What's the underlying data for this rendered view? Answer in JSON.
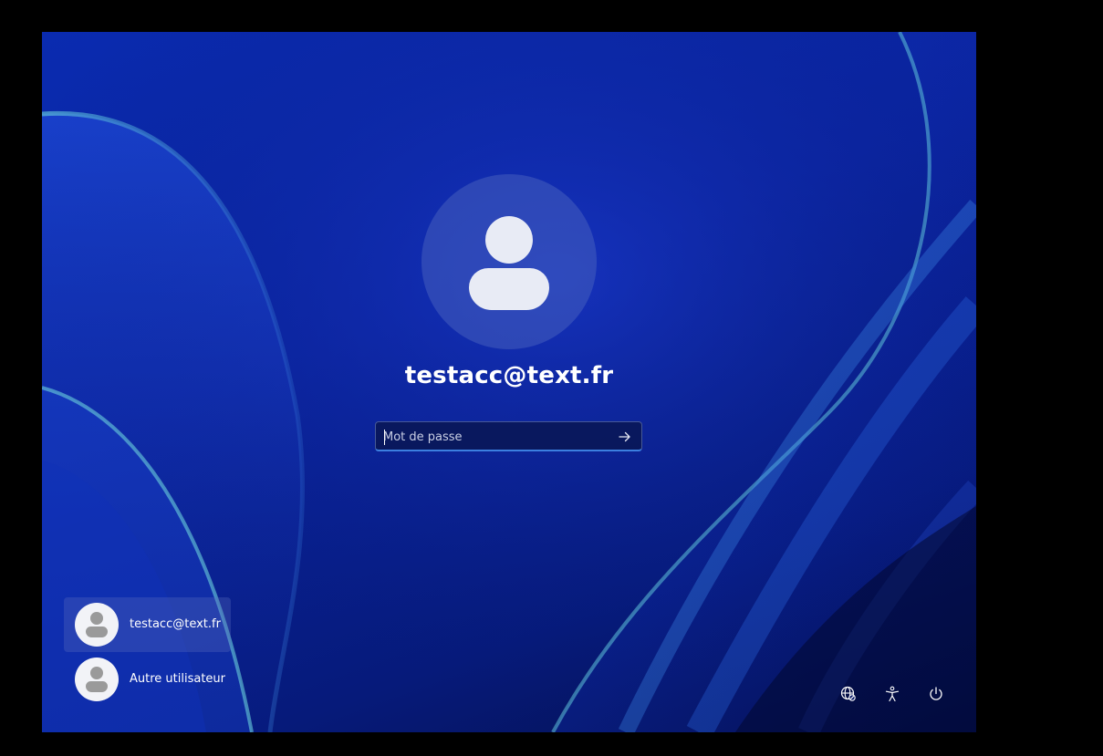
{
  "login": {
    "username": "testacc@text.fr",
    "password_placeholder": "Mot de passe",
    "password_value": "",
    "submit_icon": "arrow-right-icon",
    "avatar_icon": "user-avatar-icon"
  },
  "user_list": {
    "items": [
      {
        "label": "testacc@text.fr",
        "selected": true,
        "icon": "user-avatar-icon"
      },
      {
        "label": "Autre utilisateur",
        "selected": false,
        "icon": "user-avatar-icon"
      }
    ]
  },
  "system_icons": [
    {
      "name": "network-icon"
    },
    {
      "name": "accessibility-icon"
    },
    {
      "name": "power-icon"
    }
  ],
  "colors": {
    "background_blue": "#0a239e",
    "input_accent": "#3c7fe0",
    "text": "#ffffff"
  }
}
